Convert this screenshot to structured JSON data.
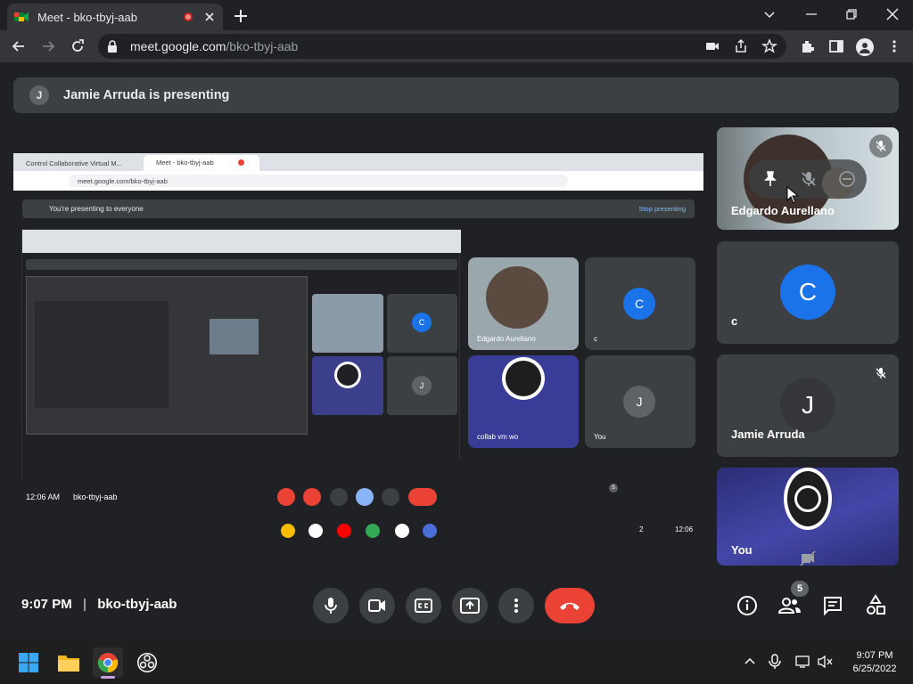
{
  "browser": {
    "tab_title": "Meet - bko-tbyj-aab",
    "url_host": "meet.google.com",
    "url_path": "/bko-tbyj-aab"
  },
  "banner": {
    "initial": "J",
    "text": "Jamie Arruda is presenting"
  },
  "shared_screen": {
    "tabs": [
      "Control Collaborative Virtual M...",
      "Meet - bko-tbyj-aab"
    ],
    "url": "meet.google.com/bko-tbyj-aab",
    "presenting_text": "You're presenting to everyone",
    "stop_presenting": "Stop presenting",
    "time": "12:06 AM",
    "meeting_code": "bko-tbyj-aab",
    "participant_count": "5",
    "tiles": [
      {
        "name": "Edgardo Aurellano"
      },
      {
        "name": "c",
        "initial": "C"
      },
      {
        "name": "collab vm wo"
      },
      {
        "name": "You",
        "initial": "J"
      }
    ],
    "taskbar_time": "12:06",
    "taskbar_badge": "2"
  },
  "participants": [
    {
      "name": "Edgardo Aurellano",
      "type": "video",
      "muted": true
    },
    {
      "name": "c",
      "initial": "C",
      "color": "#1a73e8",
      "muted": false
    },
    {
      "name": "Jamie Arruda",
      "initial": "J",
      "color": "#3c4043",
      "muted": true
    },
    {
      "name": "You",
      "type": "obs",
      "muted": true
    }
  ],
  "meeting": {
    "time": "9:07 PM",
    "code": "bko-tbyj-aab",
    "participant_count": "5"
  },
  "colors": {
    "end_call": "#ea4335",
    "accent_blue": "#1a73e8",
    "panel": "#3c4043",
    "background": "#202124"
  },
  "taskbar": {
    "time": "9:07 PM",
    "date": "6/25/2022"
  }
}
